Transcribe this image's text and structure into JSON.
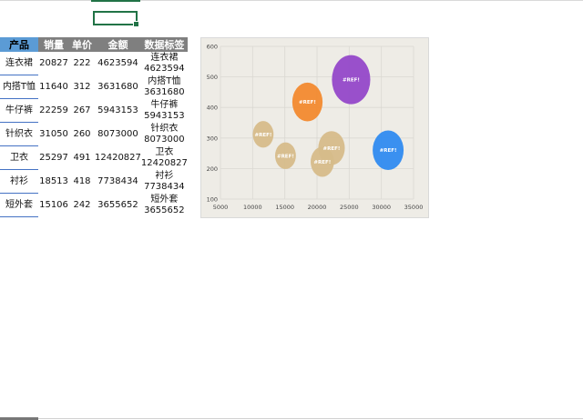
{
  "sheet": {
    "headers": [
      "产品",
      "销量",
      "单价",
      "金额",
      "数据标签"
    ],
    "rows": [
      {
        "product": "连衣裙",
        "sales": "20827",
        "price": "222",
        "amount": "4623594",
        "label_name": "连衣裙",
        "label_value": "4623594"
      },
      {
        "product": "内搭T恤",
        "sales": "11640",
        "price": "312",
        "amount": "3631680",
        "label_name": "内搭T恤",
        "label_value": "3631680"
      },
      {
        "product": "牛仔裤",
        "sales": "22259",
        "price": "267",
        "amount": "5943153",
        "label_name": "牛仔裤",
        "label_value": "5943153"
      },
      {
        "product": "针织衣",
        "sales": "31050",
        "price": "260",
        "amount": "8073000",
        "label_name": "针织衣",
        "label_value": "8073000"
      },
      {
        "product": "卫衣",
        "sales": "25297",
        "price": "491",
        "amount": "12420827",
        "label_name": "卫衣",
        "label_value": "12420827"
      },
      {
        "product": "衬衫",
        "sales": "18513",
        "price": "418",
        "amount": "7738434",
        "label_name": "衬衫",
        "label_value": "7738434"
      },
      {
        "product": "短外套",
        "sales": "15106",
        "price": "242",
        "amount": "3655652",
        "label_name": "短外套",
        "label_value": "3655652"
      }
    ]
  },
  "chart_data": {
    "type": "scatter",
    "variant": "bubble",
    "xlim": [
      5000,
      35000
    ],
    "ylim": [
      100,
      600
    ],
    "xticks": [
      "5000",
      "10000",
      "15000",
      "20000",
      "25000",
      "30000",
      "35000"
    ],
    "yticks": [
      "100",
      "200",
      "300",
      "400",
      "500",
      "600"
    ],
    "grid": true,
    "points": [
      {
        "x": 20827,
        "y": 222,
        "size": 4623594,
        "label": "#REF!",
        "color": "#d6bc8a"
      },
      {
        "x": 11640,
        "y": 312,
        "size": 3631680,
        "label": "#REF!",
        "color": "#d6bc8a"
      },
      {
        "x": 22259,
        "y": 267,
        "size": 5943153,
        "label": "#REF!",
        "color": "#d6bc8a"
      },
      {
        "x": 31050,
        "y": 260,
        "size": 8073000,
        "label": "#REF!",
        "color": "#2f8bf0"
      },
      {
        "x": 25297,
        "y": 491,
        "size": 12420827,
        "label": "#REF!",
        "color": "#9448c9"
      },
      {
        "x": 18513,
        "y": 418,
        "size": 7738434,
        "label": "#REF!",
        "color": "#f28a2f"
      },
      {
        "x": 15106,
        "y": 242,
        "size": 3655652,
        "label": "#REF!",
        "color": "#d6bc8a"
      }
    ]
  }
}
